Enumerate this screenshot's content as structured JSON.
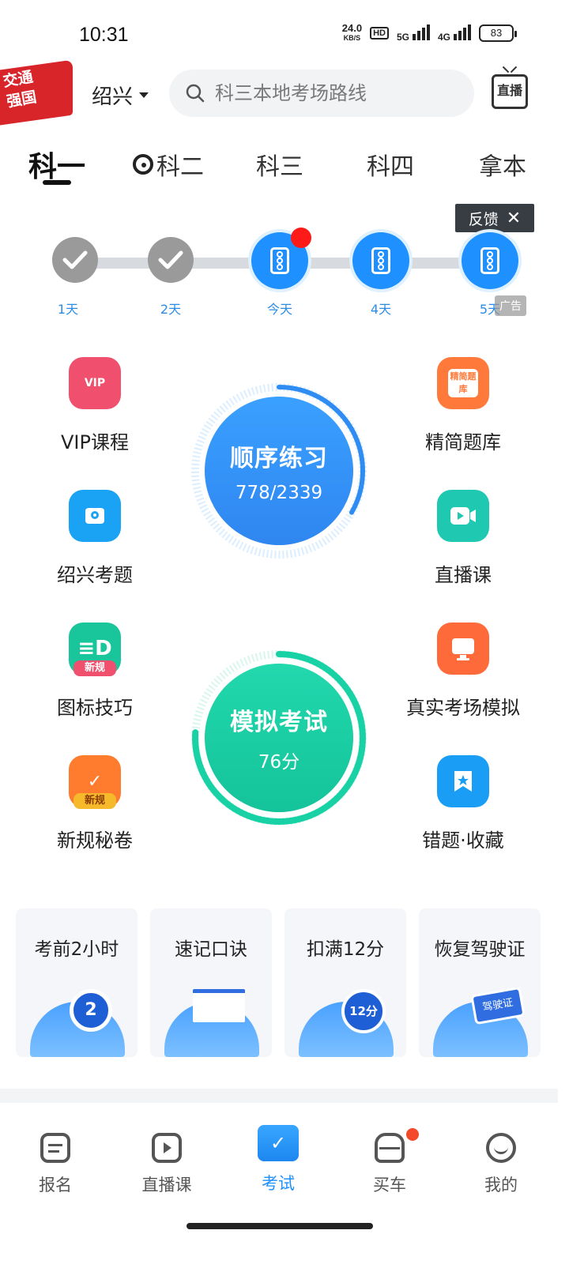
{
  "status_bar": {
    "time": "10:31",
    "speed_value": "24.0",
    "speed_unit": "KB/S",
    "hd": "HD",
    "sig1": "5G",
    "sig2": "4G",
    "battery": "83"
  },
  "header": {
    "banner_text": "交通强国",
    "city": "绍兴",
    "search_placeholder": "科三本地考场路线",
    "live_label": "直播"
  },
  "tabs": [
    "科一",
    "科二",
    "科三",
    "科四",
    "拿本"
  ],
  "progress": {
    "feedback_label": "反馈",
    "ad_label": "广告",
    "days": [
      {
        "label": "1天",
        "state": "done"
      },
      {
        "label": "2天",
        "state": "done"
      },
      {
        "label": "今天",
        "state": "today"
      },
      {
        "label": "4天",
        "state": "todo"
      },
      {
        "label": "5天",
        "state": "todo"
      }
    ]
  },
  "left_items": [
    {
      "label": "VIP课程",
      "icon": "vip-icon",
      "color": "#f0506e"
    },
    {
      "label": "绍兴考题",
      "icon": "location-icon",
      "color": "#1aa2f5"
    },
    {
      "label": "图标技巧",
      "icon": "signs-icon",
      "color": "#19c59a",
      "badge": "新规"
    },
    {
      "label": "新规秘卷",
      "icon": "paper-icon",
      "color": "#ff7b2e",
      "badge": "新规"
    }
  ],
  "right_items": [
    {
      "label": "精简题库",
      "icon": "question-bank-icon",
      "color": "#ff7a3a",
      "inner": "精简题库"
    },
    {
      "label": "直播课",
      "icon": "video-icon",
      "color": "#1ec8b1"
    },
    {
      "label": "真实考场模拟",
      "icon": "monitor-icon",
      "color": "#ff6a3a"
    },
    {
      "label": "错题·收藏",
      "icon": "bookmark-star-icon",
      "color": "#1a9ef5"
    }
  ],
  "practice": {
    "title": "顺序练习",
    "done": 778,
    "total": 2339,
    "progress_text": "778/2339",
    "accent": "#2f8cf2"
  },
  "exam": {
    "title": "模拟考试",
    "score_text": "76分",
    "score": 76,
    "accent": "#18d2a6"
  },
  "cards": [
    {
      "label": "考前2小时",
      "art_text": "2"
    },
    {
      "label": "速记口诀",
      "art_text": ""
    },
    {
      "label": "扣满12分",
      "art_text": "12分"
    },
    {
      "label": "恢复驾驶证",
      "art_text": "驾驶证"
    }
  ],
  "nav": [
    {
      "label": "报名",
      "icon": "form-icon"
    },
    {
      "label": "直播课",
      "icon": "tv-icon"
    },
    {
      "label": "考试",
      "icon": "exam-folder-icon",
      "active": true
    },
    {
      "label": "买车",
      "icon": "car-icon"
    },
    {
      "label": "我的",
      "icon": "smile-icon"
    }
  ]
}
